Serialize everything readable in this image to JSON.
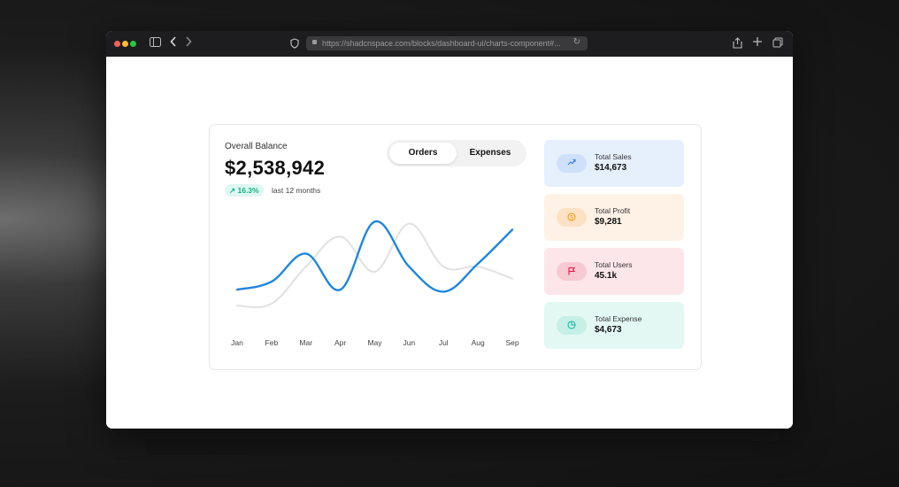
{
  "browser": {
    "url": "https://shadcnspace.com/blocks/dashboard-ui/charts-component#..."
  },
  "balance": {
    "label": "Overall Balance",
    "value": "$2,538,942",
    "change": "↗ 16.3%",
    "period": "last 12 months"
  },
  "toggle": {
    "orders": "Orders",
    "expenses": "Expenses",
    "selected": "Orders"
  },
  "stats": [
    {
      "label": "Total Sales",
      "value": "$14,673",
      "icon": "trend-up-icon",
      "bg": "#e6f0fd",
      "pill": "#cfe0fb",
      "color": "#3b82f6"
    },
    {
      "label": "Total Profit",
      "value": "$9,281",
      "icon": "coin-icon",
      "bg": "#fef2e6",
      "pill": "#fde1c4",
      "color": "#f59e0b"
    },
    {
      "label": "Total Users",
      "value": "45.1k",
      "icon": "flag-icon",
      "bg": "#fde6ea",
      "pill": "#f9c9d1",
      "color": "#e11d48"
    },
    {
      "label": "Total Expense",
      "value": "$4,673",
      "icon": "pie-icon",
      "bg": "#e3f8f3",
      "pill": "#c6efe5",
      "color": "#14b8a6"
    }
  ],
  "chart_data": {
    "type": "line",
    "categories": [
      "Jan",
      "Feb",
      "Mar",
      "Apr",
      "May",
      "Jun",
      "Jul",
      "Aug",
      "Sep"
    ],
    "series": [
      {
        "values": [
          22,
          30,
          58,
          22,
          90,
          45,
          20,
          48,
          82
        ],
        "color": "#1f86e0"
      },
      {
        "values": [
          6,
          8,
          45,
          75,
          40,
          88,
          45,
          45,
          33
        ],
        "color": "#e3e3e3"
      }
    ],
    "ylim": [
      0,
      100
    ],
    "grid": false
  }
}
